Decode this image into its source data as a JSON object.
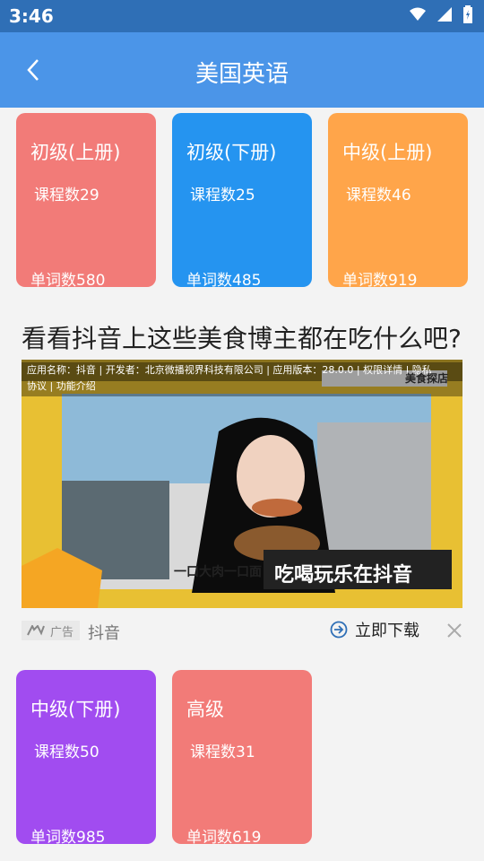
{
  "statusbar": {
    "time": "3:46",
    "icons": [
      "wifi-icon",
      "signal-icon",
      "battery-icon"
    ]
  },
  "appbar": {
    "title": "美国英语",
    "back_icon": "back-arrow-icon"
  },
  "cards_top": [
    {
      "level": "初级(上册)",
      "courses": "课程数29",
      "words": "单词数580",
      "color": "#f27b78"
    },
    {
      "level": "初级(下册)",
      "courses": "课程数25",
      "words": "单词数485",
      "color": "#2594f0"
    },
    {
      "level": "中级(上册)",
      "courses": "课程数46",
      "words": "单词数919",
      "color": "#ffa54a"
    }
  ],
  "section": {
    "title": "看看抖音上这些美食博主都在吃什么吧?"
  },
  "ad": {
    "meta_line1": "应用名称：抖音 | 开发者：北京微播视界科技有限公司 | 应用版本：28.0.0 | 权限详情 | 隐私",
    "meta_line2": "协议 | 功能介绍",
    "badge_text": "广告",
    "app_name": "抖音",
    "download_label": "立即下载",
    "close_icon": "close-icon",
    "download_icon": "download-arrow-icon",
    "banner_text": "吃喝玩乐在抖音",
    "subtitle_text": "一口大肉一口面",
    "store_label": "美食探店"
  },
  "cards_bottom": [
    {
      "level": "中级(下册)",
      "courses": "课程数50",
      "words": "单词数985",
      "color": "#a14cf0"
    },
    {
      "level": "高级",
      "courses": "课程数31",
      "words": "单词数619",
      "color": "#f27b78"
    }
  ]
}
